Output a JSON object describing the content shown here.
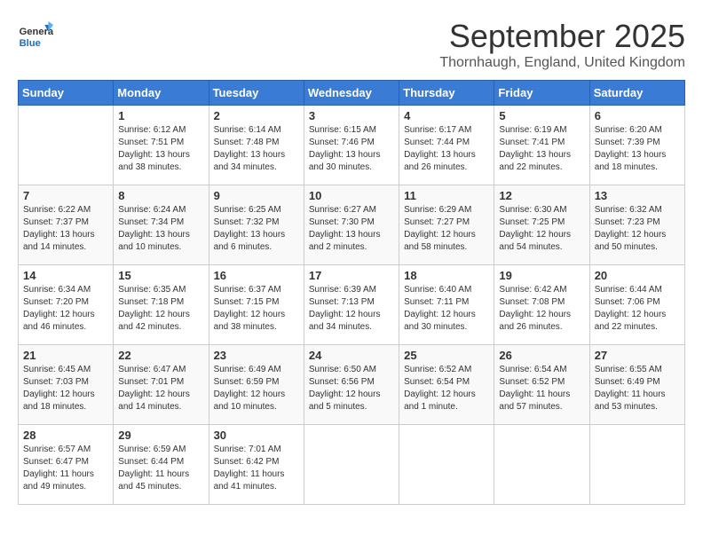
{
  "header": {
    "logo_general": "General",
    "logo_blue": "Blue",
    "month_title": "September 2025",
    "location": "Thornhaugh, England, United Kingdom"
  },
  "days_of_week": [
    "Sunday",
    "Monday",
    "Tuesday",
    "Wednesday",
    "Thursday",
    "Friday",
    "Saturday"
  ],
  "weeks": [
    [
      {
        "day": "",
        "sunrise": "",
        "sunset": "",
        "daylight": ""
      },
      {
        "day": "1",
        "sunrise": "Sunrise: 6:12 AM",
        "sunset": "Sunset: 7:51 PM",
        "daylight": "Daylight: 13 hours and 38 minutes."
      },
      {
        "day": "2",
        "sunrise": "Sunrise: 6:14 AM",
        "sunset": "Sunset: 7:48 PM",
        "daylight": "Daylight: 13 hours and 34 minutes."
      },
      {
        "day": "3",
        "sunrise": "Sunrise: 6:15 AM",
        "sunset": "Sunset: 7:46 PM",
        "daylight": "Daylight: 13 hours and 30 minutes."
      },
      {
        "day": "4",
        "sunrise": "Sunrise: 6:17 AM",
        "sunset": "Sunset: 7:44 PM",
        "daylight": "Daylight: 13 hours and 26 minutes."
      },
      {
        "day": "5",
        "sunrise": "Sunrise: 6:19 AM",
        "sunset": "Sunset: 7:41 PM",
        "daylight": "Daylight: 13 hours and 22 minutes."
      },
      {
        "day": "6",
        "sunrise": "Sunrise: 6:20 AM",
        "sunset": "Sunset: 7:39 PM",
        "daylight": "Daylight: 13 hours and 18 minutes."
      }
    ],
    [
      {
        "day": "7",
        "sunrise": "Sunrise: 6:22 AM",
        "sunset": "Sunset: 7:37 PM",
        "daylight": "Daylight: 13 hours and 14 minutes."
      },
      {
        "day": "8",
        "sunrise": "Sunrise: 6:24 AM",
        "sunset": "Sunset: 7:34 PM",
        "daylight": "Daylight: 13 hours and 10 minutes."
      },
      {
        "day": "9",
        "sunrise": "Sunrise: 6:25 AM",
        "sunset": "Sunset: 7:32 PM",
        "daylight": "Daylight: 13 hours and 6 minutes."
      },
      {
        "day": "10",
        "sunrise": "Sunrise: 6:27 AM",
        "sunset": "Sunset: 7:30 PM",
        "daylight": "Daylight: 13 hours and 2 minutes."
      },
      {
        "day": "11",
        "sunrise": "Sunrise: 6:29 AM",
        "sunset": "Sunset: 7:27 PM",
        "daylight": "Daylight: 12 hours and 58 minutes."
      },
      {
        "day": "12",
        "sunrise": "Sunrise: 6:30 AM",
        "sunset": "Sunset: 7:25 PM",
        "daylight": "Daylight: 12 hours and 54 minutes."
      },
      {
        "day": "13",
        "sunrise": "Sunrise: 6:32 AM",
        "sunset": "Sunset: 7:23 PM",
        "daylight": "Daylight: 12 hours and 50 minutes."
      }
    ],
    [
      {
        "day": "14",
        "sunrise": "Sunrise: 6:34 AM",
        "sunset": "Sunset: 7:20 PM",
        "daylight": "Daylight: 12 hours and 46 minutes."
      },
      {
        "day": "15",
        "sunrise": "Sunrise: 6:35 AM",
        "sunset": "Sunset: 7:18 PM",
        "daylight": "Daylight: 12 hours and 42 minutes."
      },
      {
        "day": "16",
        "sunrise": "Sunrise: 6:37 AM",
        "sunset": "Sunset: 7:15 PM",
        "daylight": "Daylight: 12 hours and 38 minutes."
      },
      {
        "day": "17",
        "sunrise": "Sunrise: 6:39 AM",
        "sunset": "Sunset: 7:13 PM",
        "daylight": "Daylight: 12 hours and 34 minutes."
      },
      {
        "day": "18",
        "sunrise": "Sunrise: 6:40 AM",
        "sunset": "Sunset: 7:11 PM",
        "daylight": "Daylight: 12 hours and 30 minutes."
      },
      {
        "day": "19",
        "sunrise": "Sunrise: 6:42 AM",
        "sunset": "Sunset: 7:08 PM",
        "daylight": "Daylight: 12 hours and 26 minutes."
      },
      {
        "day": "20",
        "sunrise": "Sunrise: 6:44 AM",
        "sunset": "Sunset: 7:06 PM",
        "daylight": "Daylight: 12 hours and 22 minutes."
      }
    ],
    [
      {
        "day": "21",
        "sunrise": "Sunrise: 6:45 AM",
        "sunset": "Sunset: 7:03 PM",
        "daylight": "Daylight: 12 hours and 18 minutes."
      },
      {
        "day": "22",
        "sunrise": "Sunrise: 6:47 AM",
        "sunset": "Sunset: 7:01 PM",
        "daylight": "Daylight: 12 hours and 14 minutes."
      },
      {
        "day": "23",
        "sunrise": "Sunrise: 6:49 AM",
        "sunset": "Sunset: 6:59 PM",
        "daylight": "Daylight: 12 hours and 10 minutes."
      },
      {
        "day": "24",
        "sunrise": "Sunrise: 6:50 AM",
        "sunset": "Sunset: 6:56 PM",
        "daylight": "Daylight: 12 hours and 5 minutes."
      },
      {
        "day": "25",
        "sunrise": "Sunrise: 6:52 AM",
        "sunset": "Sunset: 6:54 PM",
        "daylight": "Daylight: 12 hours and 1 minute."
      },
      {
        "day": "26",
        "sunrise": "Sunrise: 6:54 AM",
        "sunset": "Sunset: 6:52 PM",
        "daylight": "Daylight: 11 hours and 57 minutes."
      },
      {
        "day": "27",
        "sunrise": "Sunrise: 6:55 AM",
        "sunset": "Sunset: 6:49 PM",
        "daylight": "Daylight: 11 hours and 53 minutes."
      }
    ],
    [
      {
        "day": "28",
        "sunrise": "Sunrise: 6:57 AM",
        "sunset": "Sunset: 6:47 PM",
        "daylight": "Daylight: 11 hours and 49 minutes."
      },
      {
        "day": "29",
        "sunrise": "Sunrise: 6:59 AM",
        "sunset": "Sunset: 6:44 PM",
        "daylight": "Daylight: 11 hours and 45 minutes."
      },
      {
        "day": "30",
        "sunrise": "Sunrise: 7:01 AM",
        "sunset": "Sunset: 6:42 PM",
        "daylight": "Daylight: 11 hours and 41 minutes."
      },
      {
        "day": "",
        "sunrise": "",
        "sunset": "",
        "daylight": ""
      },
      {
        "day": "",
        "sunrise": "",
        "sunset": "",
        "daylight": ""
      },
      {
        "day": "",
        "sunrise": "",
        "sunset": "",
        "daylight": ""
      },
      {
        "day": "",
        "sunrise": "",
        "sunset": "",
        "daylight": ""
      }
    ]
  ]
}
